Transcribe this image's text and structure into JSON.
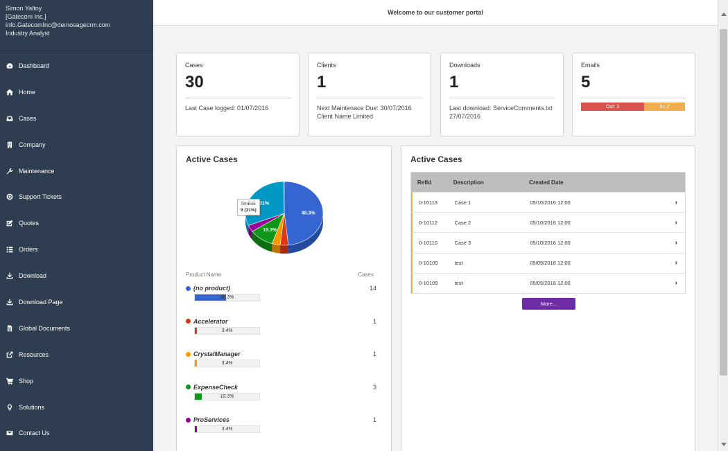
{
  "user": {
    "name": "Simon Yaltoy",
    "company": "[Gatecom Inc.]",
    "email": "info.GatecomInc@demosagecrm.com",
    "role": "Industry Analyst"
  },
  "header": {
    "welcome": "Welcome to our customer portal"
  },
  "nav": [
    {
      "label": "Dashboard",
      "icon": "dashboard-icon"
    },
    {
      "label": "Home",
      "icon": "home-icon"
    },
    {
      "label": "Cases",
      "icon": "cases-icon"
    },
    {
      "label": "Company",
      "icon": "company-icon"
    },
    {
      "label": "Maintenance",
      "icon": "wrench-icon"
    },
    {
      "label": "Support Tickets",
      "icon": "support-icon"
    },
    {
      "label": "Quotes",
      "icon": "edit-icon"
    },
    {
      "label": "Orders",
      "icon": "list-icon"
    },
    {
      "label": "Download",
      "icon": "download-icon"
    },
    {
      "label": "Download Page",
      "icon": "download-icon"
    },
    {
      "label": "Global Documents",
      "icon": "document-icon"
    },
    {
      "label": "Resources",
      "icon": "external-link-icon"
    },
    {
      "label": "Shop",
      "icon": "cart-icon"
    },
    {
      "label": "Solutions",
      "icon": "lightbulb-icon"
    },
    {
      "label": "Contact Us",
      "icon": "envelope-icon"
    }
  ],
  "stats": {
    "cases": {
      "label": "Cases",
      "value": "30",
      "sub1": "Last Case logged: 01/07/2016"
    },
    "clients": {
      "label": "Clients",
      "value": "1",
      "sub1": "Next Maintenace Due: 30/07/2016",
      "sub2": "Client Name Limited"
    },
    "downloads": {
      "label": "Downloads",
      "value": "1",
      "sub1": "Last download: ServiceComments.txt",
      "sub2": "27/07/2016"
    },
    "emails": {
      "label": "Emails",
      "value": "5",
      "out_label": "Out: 3",
      "in_label": "In: 2"
    }
  },
  "left_panel": {
    "title": "Active Cases",
    "col_product": "Product Name",
    "col_cases": "Cases",
    "tooltip_line1": "TimEx5",
    "tooltip_line2": "9 (31%)",
    "slice_labels": {
      "no_product": "48.3%",
      "expense": "10.3%",
      "timex": "31%"
    },
    "products": [
      {
        "name": "(no product)",
        "cases": "14",
        "pct": "48.3%",
        "fraction": 0.483,
        "color": "#3465d1"
      },
      {
        "name": "Accelerator",
        "cases": "1",
        "pct": "3.4%",
        "fraction": 0.034,
        "color": "#dc3912"
      },
      {
        "name": "CrystalManager",
        "cases": "1",
        "pct": "3.4%",
        "fraction": 0.034,
        "color": "#ff9900"
      },
      {
        "name": "ExpenseCheck",
        "cases": "3",
        "pct": "10.3%",
        "fraction": 0.103,
        "color": "#109618"
      },
      {
        "name": "ProServices",
        "cases": "1",
        "pct": "3.4%",
        "fraction": 0.034,
        "color": "#990099"
      }
    ],
    "pie": [
      {
        "name": "(no product)",
        "fraction": 0.483,
        "color": "#3465d1",
        "dark": "#234a9e"
      },
      {
        "name": "Accelerator",
        "fraction": 0.034,
        "color": "#dc3912",
        "dark": "#a52a0d"
      },
      {
        "name": "CrystalManager",
        "fraction": 0.034,
        "color": "#ff9900",
        "dark": "#bf7300"
      },
      {
        "name": "ExpenseCheck",
        "fraction": 0.103,
        "color": "#109618",
        "dark": "#0b6e11"
      },
      {
        "name": "ProServices",
        "fraction": 0.034,
        "color": "#990099",
        "dark": "#700070"
      },
      {
        "name": "TimEx5",
        "fraction": 0.31,
        "color": "#0099c6",
        "dark": "#0077a0"
      }
    ]
  },
  "right_panel": {
    "title": "Active Cases",
    "columns": [
      "RefId",
      "Description",
      "Created Date"
    ],
    "rows": [
      [
        "0-10113",
        "Case 1",
        "05/10/2016 12:00"
      ],
      [
        "0-10112",
        "Case 2",
        "05/10/2016 12:00"
      ],
      [
        "0-10110",
        "Case 3",
        "05/10/2016 12:00"
      ],
      [
        "0-10109",
        "test",
        "05/09/2016 12:00"
      ],
      [
        "0-10109",
        "test",
        "05/09/2016 12:00"
      ]
    ],
    "row_chevron": "›",
    "more_label": "More..."
  }
}
